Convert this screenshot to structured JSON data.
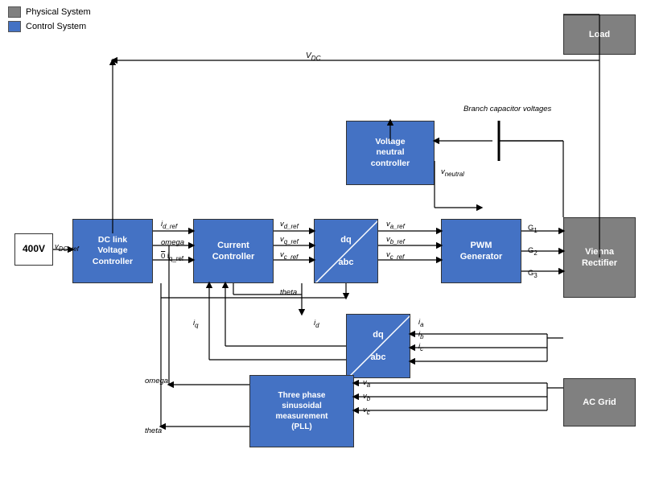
{
  "legend": {
    "physical_system": "Physical System",
    "control_system": "Control System"
  },
  "blocks": {
    "load": {
      "label": "Load",
      "type": "gray"
    },
    "vienna_rectifier": {
      "label": "Vienna\nRectifier",
      "type": "gray"
    },
    "ac_grid": {
      "label": "AC Grid",
      "type": "gray"
    },
    "v400": {
      "label": "400V",
      "type": "white"
    },
    "dc_link": {
      "label": "DC link\nVoltage\nController",
      "type": "blue"
    },
    "current_controller": {
      "label": "Current\nController",
      "type": "blue"
    },
    "dq_abc_top": {
      "label": "dq\n\nabc",
      "type": "blue"
    },
    "pwm_generator": {
      "label": "PWM\nGenerator",
      "type": "blue"
    },
    "voltage_neutral": {
      "label": "Voltage\nneutral\ncontroller",
      "type": "blue"
    },
    "dq_abc_bottom": {
      "label": "dq\n\nabc",
      "type": "blue"
    },
    "three_phase": {
      "label": "Three phase\nsinusoidal\nmeasurement\n(PLL)",
      "type": "blue"
    }
  },
  "signals": {
    "vdc_ref": "v_DC_ref",
    "vdc": "V_DC",
    "id_ref": "i_d_ref",
    "omega": "omega",
    "iq_ref": "i_q_ref",
    "vd_ref": "v_d_ref",
    "vq_ref": "v_q_ref",
    "vc_ref": "v_c_ref",
    "va_ref": "v_a_ref",
    "vb_ref": "v_b_ref",
    "vc_ref2": "v_c_ref",
    "theta": "theta",
    "iq": "i_q",
    "id": "i_d",
    "ia": "i_a",
    "ib": "i_b",
    "ic": "i_c",
    "va": "v_a",
    "vb": "v_b",
    "vc": "v_c",
    "vneutral": "v_neutral",
    "g1": "G_1",
    "g2": "G_2",
    "g3": "G_3",
    "branch_cap": "Branch capacitor voltages"
  }
}
